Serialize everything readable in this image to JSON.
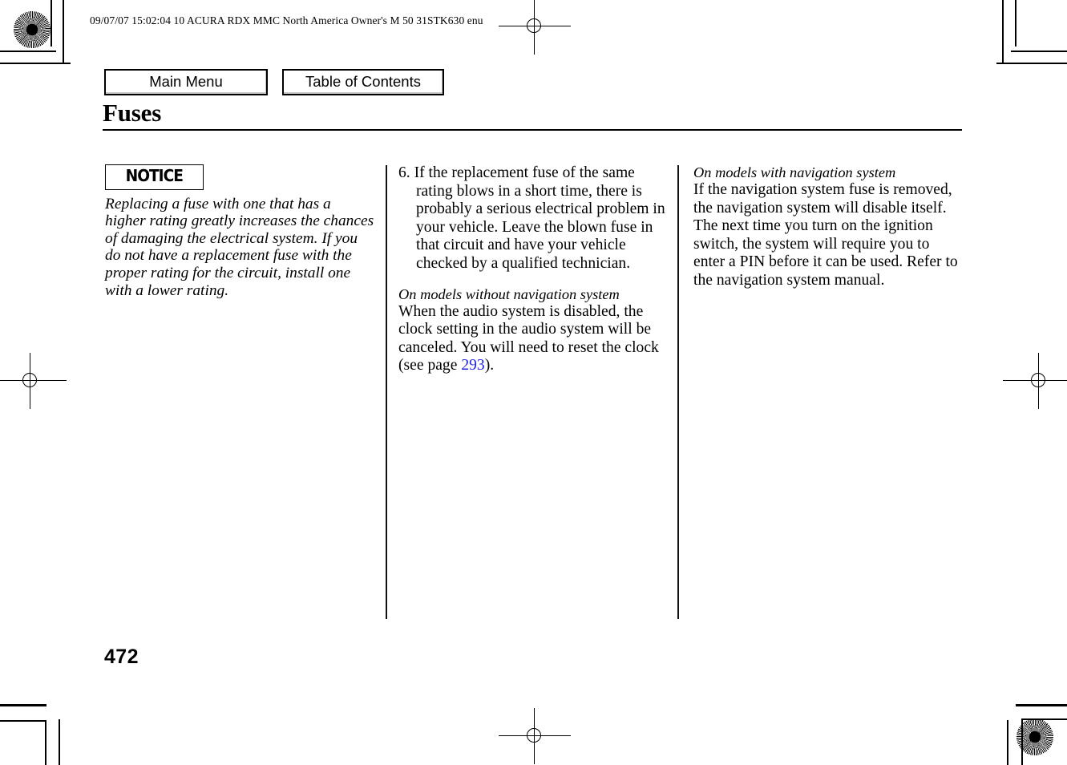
{
  "header": {
    "slug": "09/07/07 15:02:04    10 ACURA RDX MMC North America Owner's M 50 31STK630 enu"
  },
  "nav": {
    "main_menu_label": "Main Menu",
    "table_of_contents_label": "Table of Contents"
  },
  "title": "Fuses",
  "columns": {
    "left": {
      "notice_label": "NOTICE",
      "notice_body": "Replacing a fuse with one that has a higher rating greatly increases the chances of damaging the electrical system. If you do not have a replacement fuse with the proper rating for the circuit, install one with a lower rating."
    },
    "middle": {
      "step_number": "6.",
      "step_text": "If the replacement fuse of the same rating blows in a short time, there is probably a serious electrical problem in your vehicle. Leave the blown fuse in that circuit and have your vehicle checked by a qualified technician.",
      "subhead": "On models without navigation system",
      "body_before_link": "When the audio system is disabled, the clock setting in the audio system will be canceled. You will need to reset the clock (see page ",
      "page_link": "293",
      "body_after_link": ")."
    },
    "right": {
      "subhead": "On models with navigation system",
      "body": "If the navigation system fuse is removed, the navigation system will disable itself. The next time you turn on the ignition switch, the system will require you to enter a PIN before it can be used. Refer to the navigation system manual."
    }
  },
  "folio": "472",
  "colors": {
    "link": "#2424dd",
    "rule": "#000000",
    "paper": "#ffffff"
  }
}
